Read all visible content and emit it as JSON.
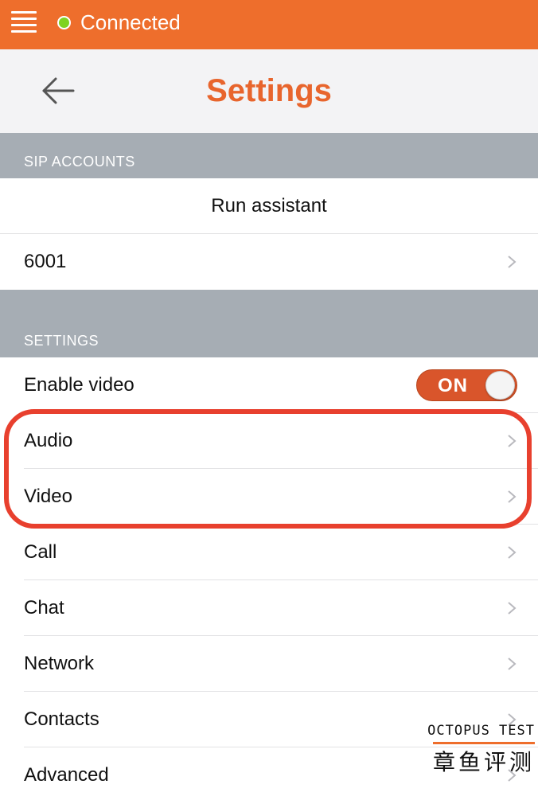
{
  "status_bar": {
    "status_text": "Connected",
    "status_color": "#7ED321",
    "background_color": "#EE6E2C"
  },
  "header": {
    "title": "Settings",
    "back_icon": "arrow-left-icon",
    "title_color": "#E8652D"
  },
  "sip_accounts": {
    "header": "SIP ACCOUNTS",
    "run_assistant": "Run assistant",
    "accounts": [
      {
        "label": "6001"
      }
    ]
  },
  "settings": {
    "header": "SETTINGS",
    "enable_video": {
      "label": "Enable video",
      "toggle_label": "ON",
      "toggle_state": true
    },
    "items": [
      {
        "label": "Audio"
      },
      {
        "label": "Video"
      },
      {
        "label": "Call"
      },
      {
        "label": "Chat"
      },
      {
        "label": "Network"
      },
      {
        "label": "Contacts"
      },
      {
        "label": "Advanced"
      }
    ]
  },
  "annotation": {
    "highlight_color": "#E8402E"
  },
  "watermark": {
    "text_en": "OCTOPUS TEST",
    "text_cn": "章鱼评测"
  }
}
